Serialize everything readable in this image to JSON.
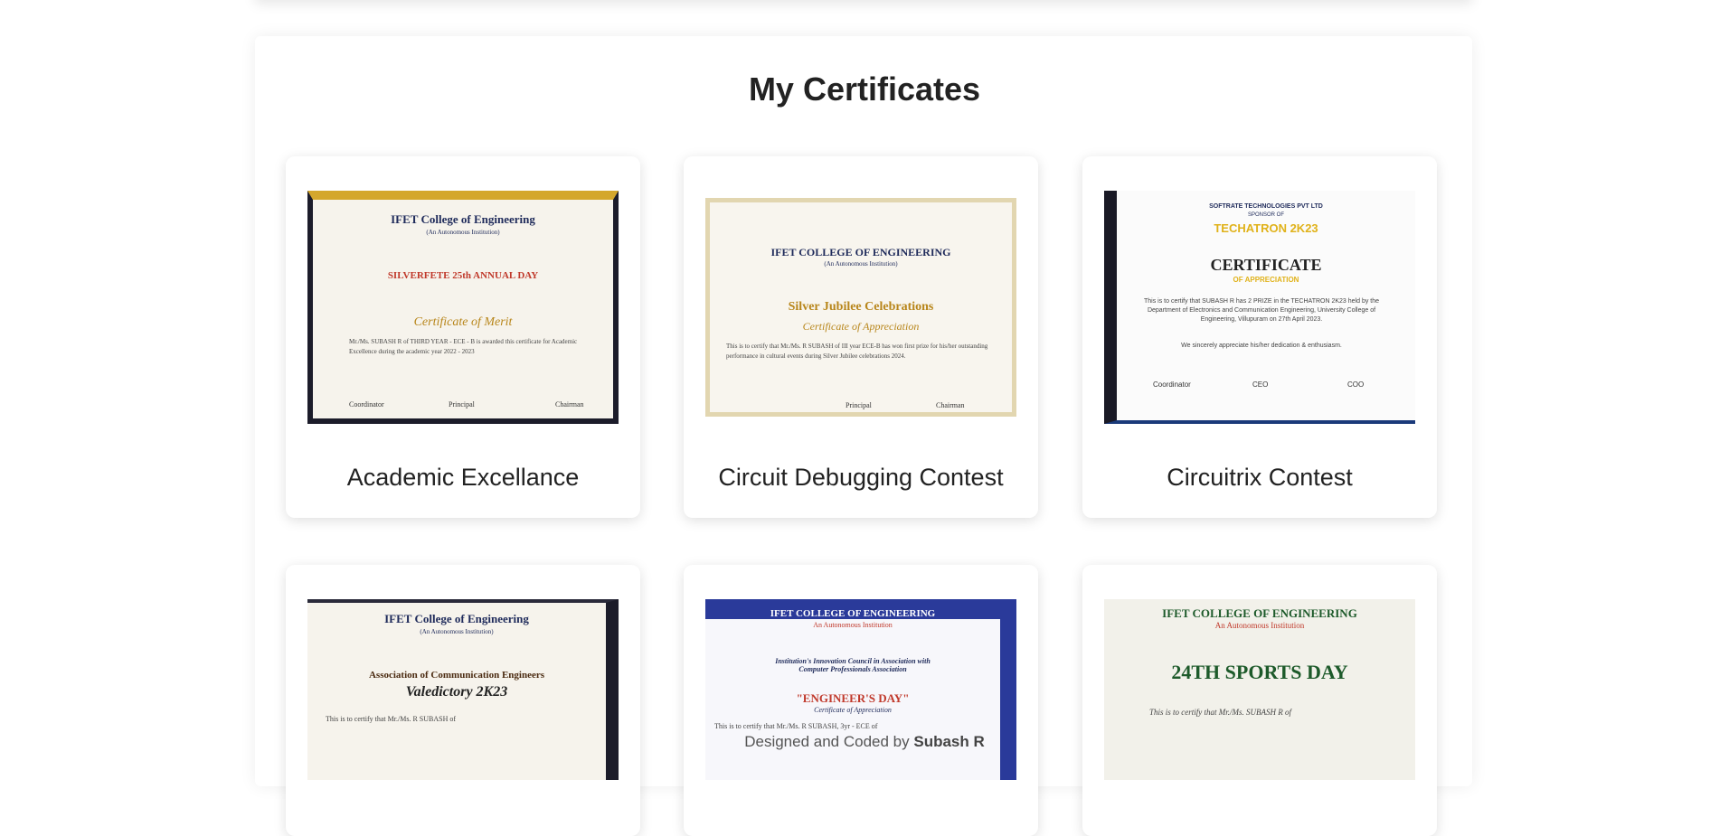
{
  "page": {
    "title": "My Certificates",
    "footer_prefix": "Designed and Coded by",
    "footer_author": "Subash R"
  },
  "certificates": [
    {
      "title": "Academic Excellance",
      "institution": "IFET College of Engineering",
      "subtitle": "(An Autonomous Institution)",
      "event": "SILVERFETE 25th ANNUAL DAY",
      "heading": "Certificate of Merit",
      "body": "Mr./Ms. SUBASH R of THIRD YEAR - ECE - B is awarded this certificate for Academic Excellence during the academic year 2022 - 2023",
      "signatures": [
        "Coordinator",
        "Principal",
        "Chairman"
      ]
    },
    {
      "title": "Circuit Debugging Contest",
      "institution": "IFET COLLEGE OF ENGINEERING",
      "subtitle": "(An Autonomous Institution)",
      "event": "Silver Jubilee Celebrations",
      "heading": "Certificate of Appreciation",
      "body": "This is to certify that Mr./Ms. R SUBASH of III year ECE-B has won first prize for his/her outstanding performance in cultural events during Silver Jubilee celebrations 2024.",
      "signatures": [
        "",
        "Principal",
        "Chairman"
      ]
    },
    {
      "title": "Circuitrix Contest",
      "institution": "SOFTRATE TECHNOLOGIES PVT LTD",
      "subtitle": "SPONSOR OF",
      "event": "TECHATRON 2K23",
      "heading": "CERTIFICATE",
      "subheading": "OF APPRECIATION",
      "body": "This is to certify that SUBASH R has 2 PRIZE in the TECHATRON 2K23 held by the Department of Electronics and Communication Engineering, University College of Engineering, Villupuram on 27th April 2023.",
      "note": "We sincerely appreciate his/her dedication & enthusiasm.",
      "signatures": [
        "Coordinator",
        "CEO",
        "COO"
      ]
    },
    {
      "title": "",
      "institution": "IFET College of Engineering",
      "subtitle": "(An Autonomous Institution)",
      "event": "Association of Communication Engineers",
      "heading": "Valedictory 2K23",
      "body": "This is to certify that Mr./Ms. R SUBASH of"
    },
    {
      "title": "",
      "institution": "IFET COLLEGE OF ENGINEERING",
      "subtitle": "An Autonomous Institution",
      "event": "Institution's Innovation Council in Association with Computer Professionals Association",
      "heading": "\"ENGINEER'S DAY\"",
      "subheading": "Certificate of Appreciation",
      "body": "This is to certify that Mr./Ms. R SUBASH, 3yr - ECE of"
    },
    {
      "title": "",
      "institution": "IFET COLLEGE OF ENGINEERING",
      "subtitle": "An Autonomous Institution",
      "event": "24TH SPORTS DAY",
      "body": "This is to certify that Mr./Ms. SUBASH R of"
    }
  ]
}
